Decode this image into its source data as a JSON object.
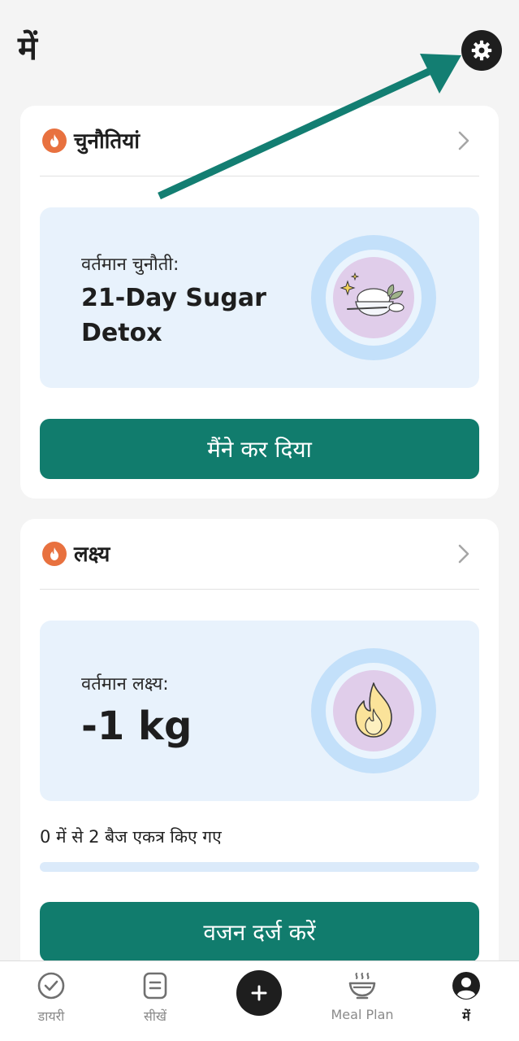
{
  "header": {
    "title": "में",
    "settings_icon": "gear-icon"
  },
  "challenges_card": {
    "title": "चुनौतियां",
    "current_label": "वर्तमान चुनौती:",
    "current_value": "21-Day Sugar Detox",
    "illustration": "rice-bowl-sparkle-icon",
    "button_label": "मैंने कर दिया"
  },
  "goals_card": {
    "title": "लक्ष्य",
    "current_label": "वर्तमान लक्ष्य:",
    "current_value": "-1 kg",
    "illustration": "flame-icon",
    "badges_text": "0 में से 2 बैज एकत्र किए गए",
    "badges_progress": 0,
    "button_label": "वजन दर्ज करें"
  },
  "bottom_nav": {
    "items": [
      {
        "label": "डायरी",
        "icon": "check-circle-icon",
        "active": false
      },
      {
        "label": "सीखें",
        "icon": "notes-icon",
        "active": false
      },
      {
        "label": "",
        "icon": "plus-icon",
        "active": false
      },
      {
        "label": "Meal Plan",
        "icon": "steaming-bowl-icon",
        "active": false
      },
      {
        "label": "में",
        "icon": "profile-icon",
        "active": true
      }
    ]
  },
  "colors": {
    "accent": "#117c6d",
    "fire_badge": "#e8713f",
    "panel_bg": "#e8f2fc",
    "page_bg": "#f4f4f4"
  }
}
